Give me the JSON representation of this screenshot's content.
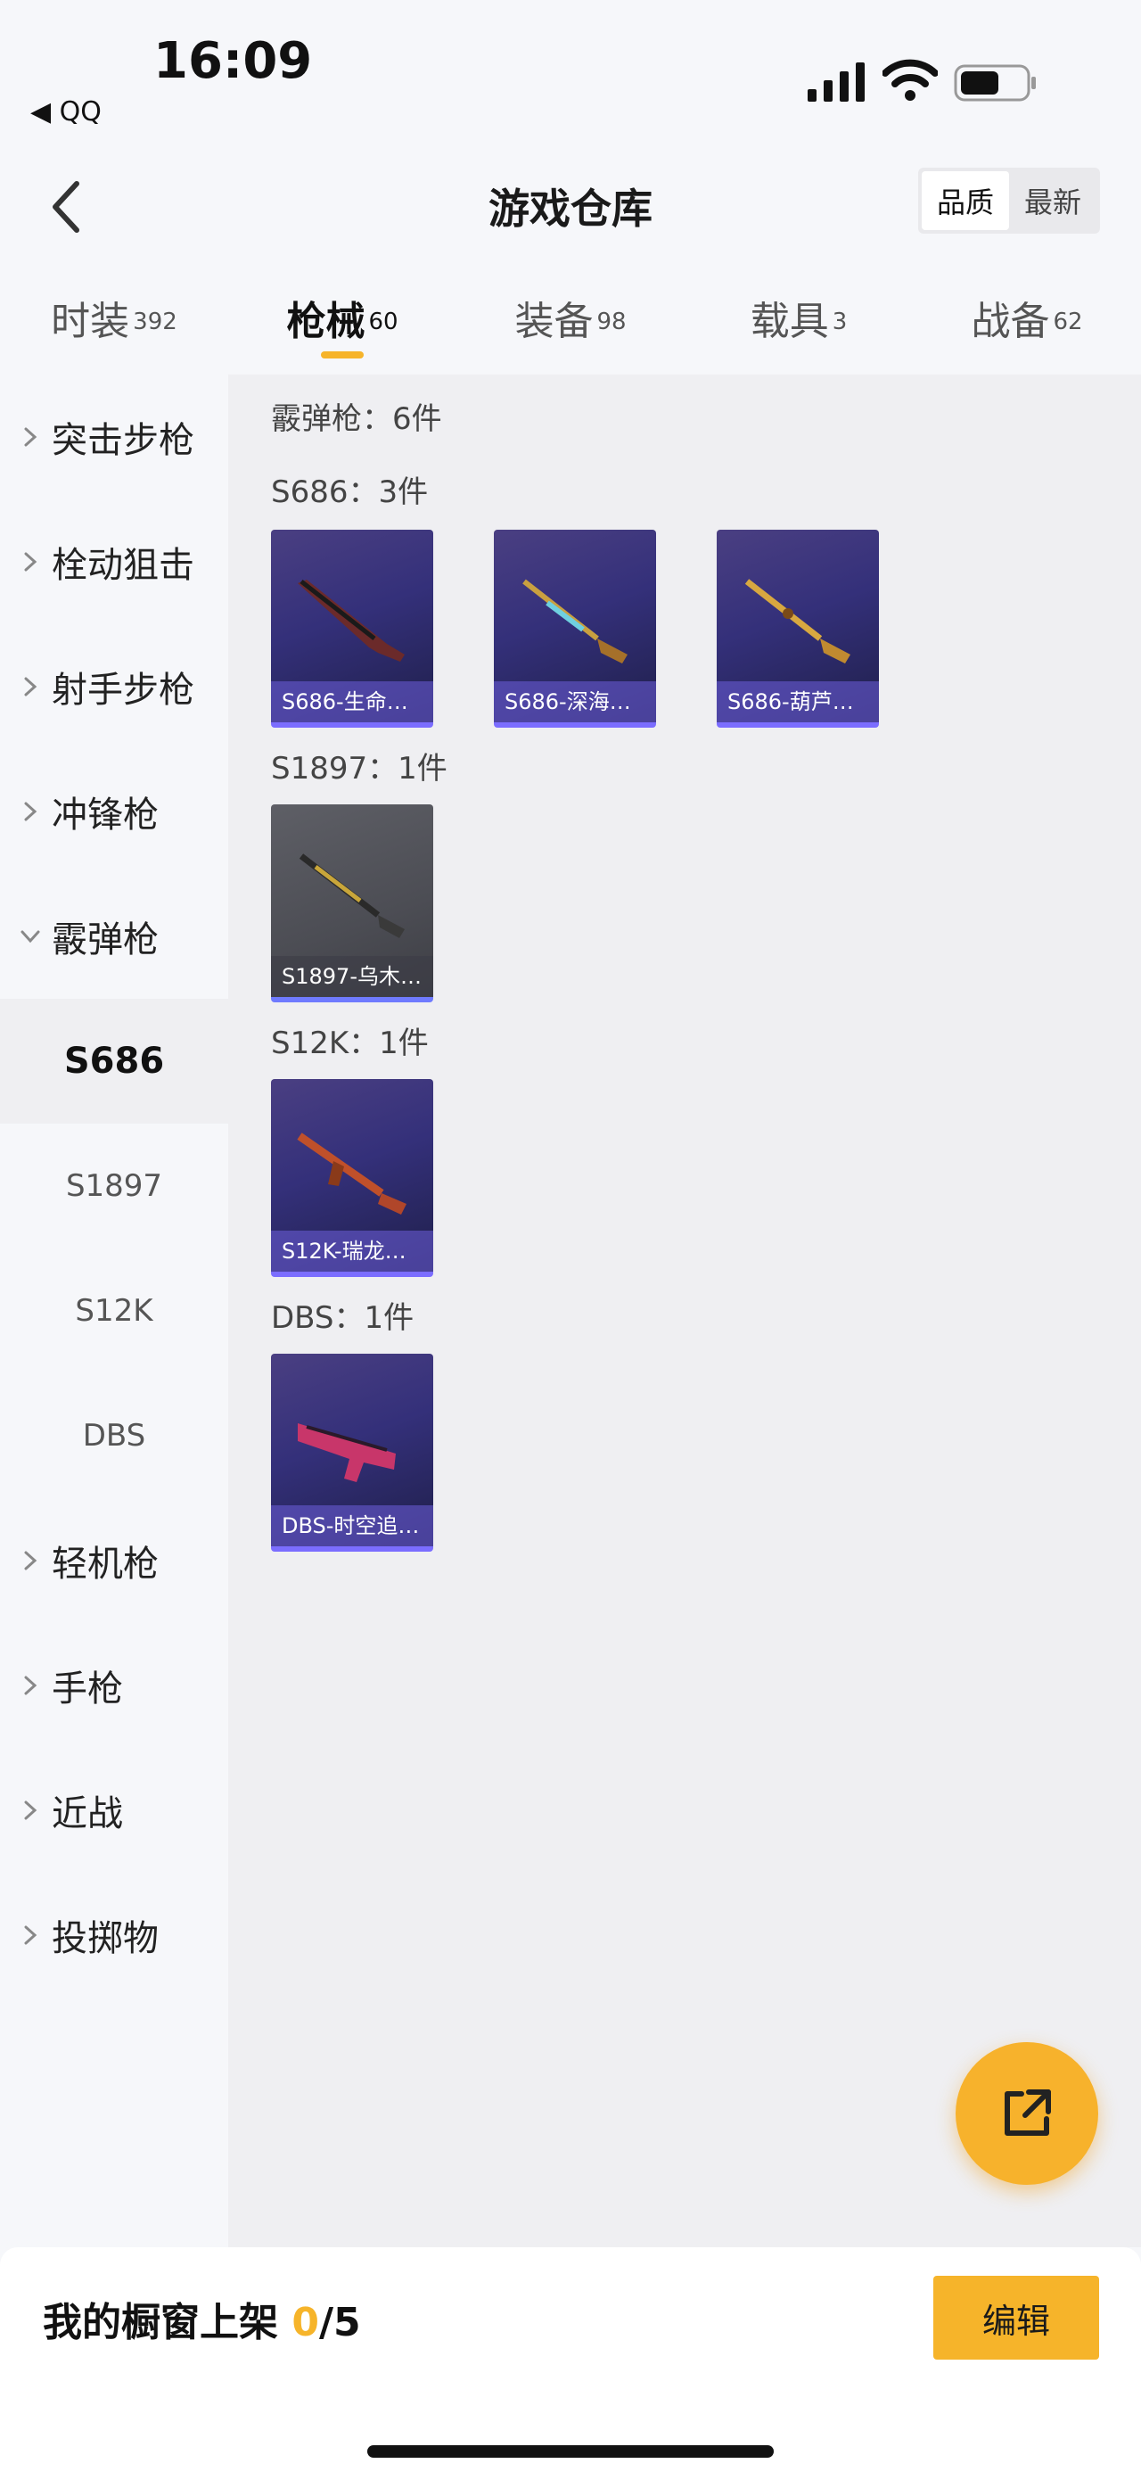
{
  "status_bar": {
    "time": "16:09",
    "back_app": "◀ QQ"
  },
  "nav": {
    "title": "游戏仓库",
    "sort_options": [
      "品质",
      "最新"
    ],
    "active_sort": "品质"
  },
  "tabs": [
    {
      "label": "时装",
      "count": "392",
      "active": false
    },
    {
      "label": "枪械",
      "count": "60",
      "active": true
    },
    {
      "label": "装备",
      "count": "98",
      "active": false
    },
    {
      "label": "载具",
      "count": "3",
      "active": false
    },
    {
      "label": "战备",
      "count": "62",
      "active": false
    }
  ],
  "sidebar": {
    "groups": [
      {
        "label": "突击步枪",
        "expanded": false
      },
      {
        "label": "栓动狙击",
        "expanded": false
      },
      {
        "label": "射手步枪",
        "expanded": false
      },
      {
        "label": "冲锋枪",
        "expanded": false
      },
      {
        "label": "霰弹枪",
        "expanded": true
      },
      {
        "label": "轻机枪",
        "expanded": false
      },
      {
        "label": "手枪",
        "expanded": false
      },
      {
        "label": "近战",
        "expanded": false
      },
      {
        "label": "投掷物",
        "expanded": false
      }
    ],
    "sub_items": [
      "S686",
      "S1897",
      "S12K",
      "DBS"
    ],
    "active_sub": "S686"
  },
  "content": {
    "summary": "霰弹枪：6件",
    "sections": [
      {
        "title": "S686：3件",
        "items": [
          {
            "label": "S686-生命…",
            "style": "purple"
          },
          {
            "label": "S686-深海…",
            "style": "purple"
          },
          {
            "label": "S686-葫芦…",
            "style": "purple"
          }
        ]
      },
      {
        "title": "S1897：1件",
        "items": [
          {
            "label": "S1897-乌木…",
            "style": "gray"
          }
        ]
      },
      {
        "title": "S12K：1件",
        "items": [
          {
            "label": "S12K-瑞龙…",
            "style": "purple"
          }
        ]
      },
      {
        "title": "DBS：1件",
        "items": [
          {
            "label": "DBS-时空追…",
            "style": "purple"
          }
        ]
      }
    ]
  },
  "bottom": {
    "showcase_prefix": "我的橱窗上架",
    "showcase_used": "0",
    "showcase_total": "/5",
    "edit_label": "编辑"
  },
  "colors": {
    "accent": "#f6b42a",
    "card_purple": "#34307a",
    "card_border": "#7b6dff"
  },
  "icons": [
    "back-chevron-icon",
    "share-export-icon",
    "chevron-right-icon",
    "chevron-down-icon",
    "signal-icon",
    "wifi-icon",
    "battery-icon"
  ]
}
